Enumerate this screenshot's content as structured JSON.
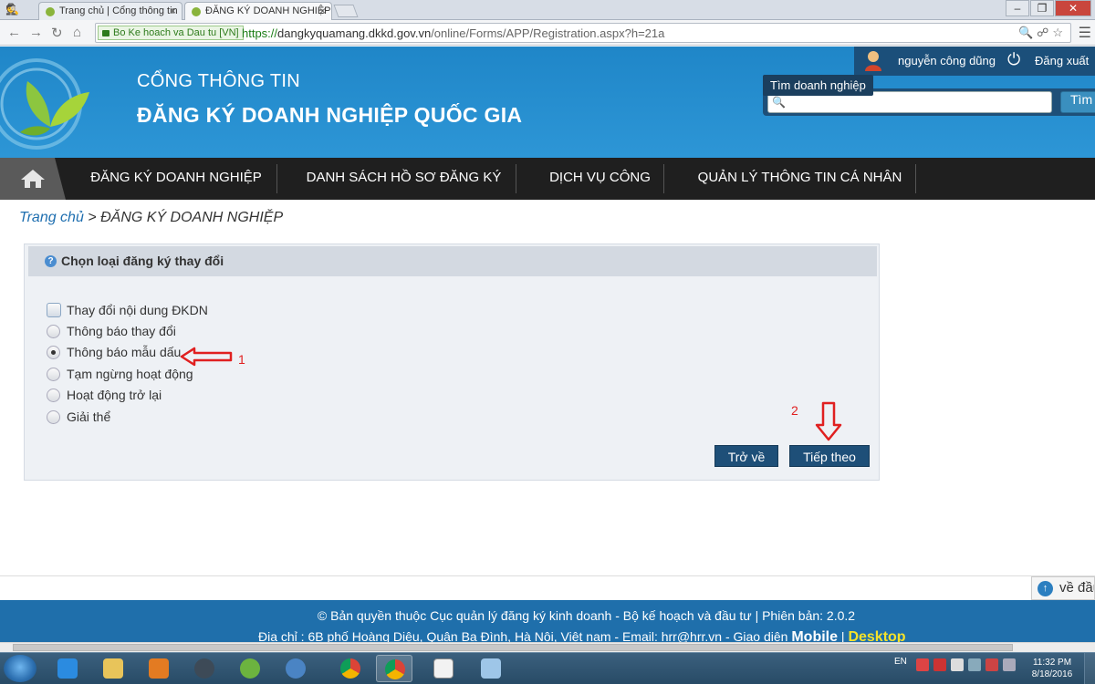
{
  "browser": {
    "tabs": [
      {
        "title": "Trang chủ | Cổng thông tin"
      },
      {
        "title": "ĐĂNG KÝ DOANH NGHIỆP"
      }
    ],
    "ev_label": "Bo Ke hoach va Dau tu [VN]",
    "url_scheme": "https://",
    "url_host": "dangkyquamang.dkkd.gov.vn",
    "url_path": "/online/Forms/APP/Registration.aspx?h=21a"
  },
  "header": {
    "portal_sub": "CỔNG THÔNG TIN",
    "portal_title": "ĐĂNG KÝ DOANH NGHIỆP QUỐC GIA",
    "user_name": "nguyễn công dũng",
    "logout": "Đăng xuất",
    "search_placeholder": "",
    "search_button": "Tìm",
    "search_tooltip": "Tìm doanh nghiệp"
  },
  "nav": {
    "items": [
      {
        "label": "ĐĂNG KÝ DOANH NGHIỆP"
      },
      {
        "label": "DANH SÁCH HỒ SƠ ĐĂNG KÝ"
      },
      {
        "label": "DỊCH VỤ CÔNG"
      },
      {
        "label": "QUẢN LÝ THÔNG TIN CÁ NHÂN"
      }
    ]
  },
  "breadcrumb": {
    "home": "Trang chủ",
    "separator": " > ",
    "current": "ĐĂNG KÝ DOANH NGHIỆP"
  },
  "panel": {
    "title": "Chọn loại đăng ký thay đổi",
    "options": [
      {
        "label": "Thay đổi nội dung ĐKDN",
        "type": "checkbox",
        "checked": false
      },
      {
        "label": "Thông báo thay đổi",
        "type": "radio",
        "checked": false
      },
      {
        "label": "Thông báo mẫu dấu",
        "type": "radio",
        "checked": true
      },
      {
        "label": "Tạm ngừng hoạt động",
        "type": "radio",
        "checked": false
      },
      {
        "label": "Hoạt động trở lại",
        "type": "radio",
        "checked": false
      },
      {
        "label": "Giải thể",
        "type": "radio",
        "checked": false
      }
    ],
    "back_button": "Trở về",
    "next_button": "Tiếp theo"
  },
  "annotations": {
    "label_1": "1",
    "label_2": "2",
    "color": "#e02020"
  },
  "scroll_top": "về đầu trang",
  "footer": {
    "copyright": "© Bản quyền thuộc Cục quản lý đăng ký kinh doanh - Bộ kế hoạch và đầu tư | Phiên bản: 2.0.2",
    "address": "Địa chỉ : 6B phố Hoàng Diệu, Quận Ba Đình, Hà Nội, Việt nam - Email: hrr@hrr.vn - Giao diện",
    "mobile": "Mobile",
    "sep": "|",
    "desktop": "Desktop"
  },
  "taskbar": {
    "lang": "EN",
    "time": "11:32 PM",
    "date": "8/18/2016"
  },
  "colors": {
    "header_blue": "#1f86c8",
    "nav_black": "#1f1f1f",
    "button_navy": "#1e4f78",
    "footer_blue": "#1f6fab"
  }
}
